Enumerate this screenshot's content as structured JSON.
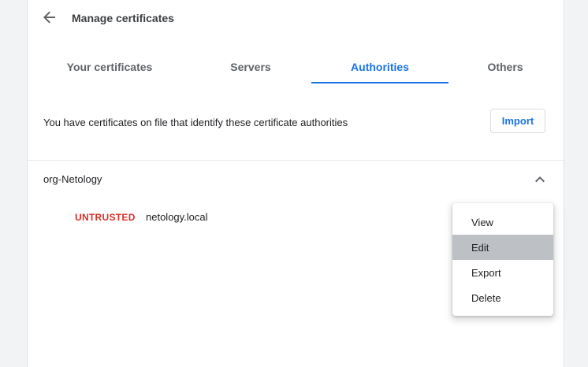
{
  "header": {
    "title": "Manage certificates"
  },
  "tabs": [
    {
      "label": "Your certificates"
    },
    {
      "label": "Servers"
    },
    {
      "label": "Authorities"
    },
    {
      "label": "Others"
    }
  ],
  "active_tab": "Authorities",
  "info": {
    "text": "You have certificates on file that identify these certificate authorities",
    "import_label": "Import"
  },
  "org": {
    "name": "org-Netology",
    "certificates": [
      {
        "status": "UNTRUSTED",
        "name": "netology.local"
      }
    ]
  },
  "context_menu": {
    "items": [
      {
        "label": "View"
      },
      {
        "label": "Edit"
      },
      {
        "label": "Export"
      },
      {
        "label": "Delete"
      }
    ],
    "highlighted": "Edit"
  },
  "colors": {
    "accent": "#1a73e8",
    "untrusted": "#d93025",
    "menu_highlight": "#bdc1c6"
  },
  "icons": {
    "back": "arrow-back-icon",
    "expand": "chevron-up-icon"
  }
}
